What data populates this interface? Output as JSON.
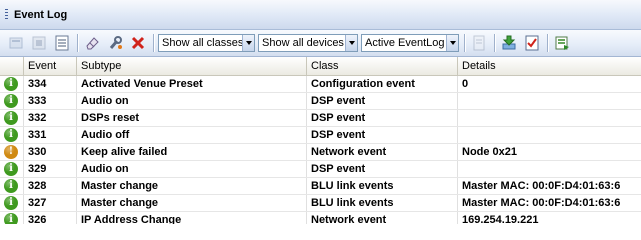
{
  "window": {
    "title": "Event Log"
  },
  "toolbar": {
    "buttons": [
      {
        "name": "clear-filter-icon",
        "enabled": false
      },
      {
        "name": "stop-icon",
        "enabled": false
      },
      {
        "name": "list-icon",
        "enabled": true
      },
      {
        "name": "eraser-icon",
        "enabled": true
      },
      {
        "name": "wrench-icon",
        "enabled": true
      },
      {
        "name": "delete-icon",
        "enabled": true
      }
    ],
    "class_filter": "Show all classes",
    "device_filter": "Show all devices",
    "log_filter": "Active EventLog",
    "right_buttons": [
      {
        "name": "document-icon",
        "enabled": false
      },
      {
        "name": "download-icon",
        "enabled": true
      },
      {
        "name": "checklist-icon",
        "enabled": true
      },
      {
        "name": "export-icon",
        "enabled": true
      }
    ]
  },
  "table": {
    "columns": [
      "",
      "Event",
      "Subtype",
      "Class",
      "Details"
    ],
    "rows": [
      {
        "status": "info",
        "event": "334",
        "subtype": "Activated Venue Preset",
        "class": "Configuration event",
        "details": "0"
      },
      {
        "status": "info",
        "event": "333",
        "subtype": "Audio on",
        "class": "DSP event",
        "details": ""
      },
      {
        "status": "info",
        "event": "332",
        "subtype": "DSPs reset",
        "class": "DSP event",
        "details": ""
      },
      {
        "status": "info",
        "event": "331",
        "subtype": "Audio off",
        "class": "DSP event",
        "details": ""
      },
      {
        "status": "warning",
        "event": "330",
        "subtype": "Keep alive failed",
        "class": "Network event",
        "details": "Node 0x21"
      },
      {
        "status": "info",
        "event": "329",
        "subtype": "Audio on",
        "class": "DSP event",
        "details": ""
      },
      {
        "status": "info",
        "event": "328",
        "subtype": "Master change",
        "class": "BLU link events",
        "details": "Master MAC: 00:0F:D4:01:63:6"
      },
      {
        "status": "info",
        "event": "327",
        "subtype": "Master change",
        "class": "BLU link events",
        "details": "Master MAC: 00:0F:D4:01:63:6"
      },
      {
        "status": "info",
        "event": "326",
        "subtype": "IP Address Change",
        "class": "Network event",
        "details": "169.254.19.221"
      }
    ]
  },
  "colors": {
    "info": "#3f9a1f",
    "warning": "#d08a12",
    "accent": "#dfe8f6"
  }
}
